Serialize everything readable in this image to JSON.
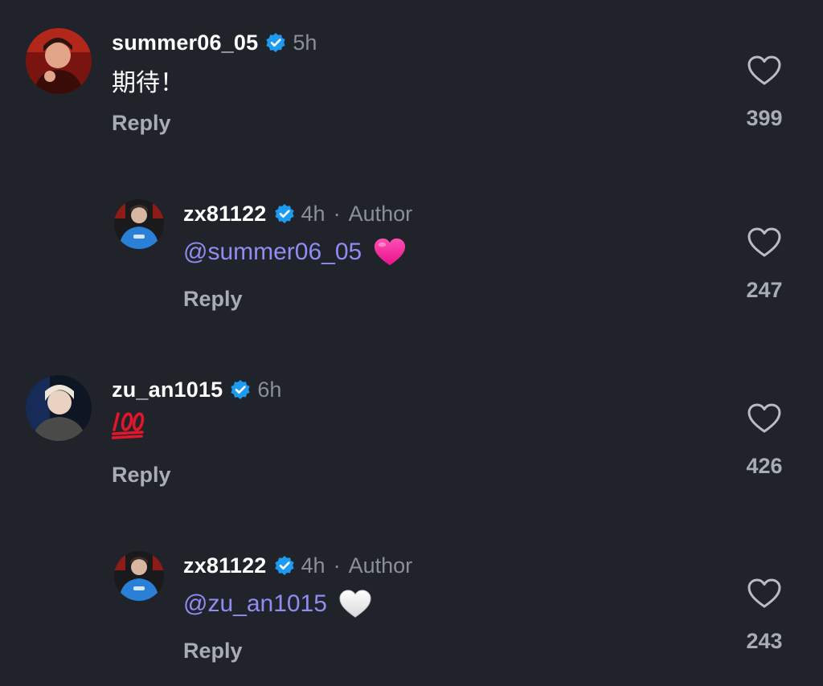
{
  "colors": {
    "background": "#202329",
    "mention": "#8f8cf2",
    "verified": "#1d9bf0",
    "muted": "#8a8f98"
  },
  "comments": [
    {
      "username": "summer06_05",
      "time": "5h",
      "text": "期待！",
      "reply_label": "Reply",
      "likes": "399",
      "verified_icon": "verified-badge-icon",
      "like_icon": "heart-outline-icon"
    },
    {
      "username": "zx81122",
      "time": "4h",
      "separator": "·",
      "author_label": "Author",
      "mention": "@summer06_05",
      "emoji": "pink-heart-emoji",
      "reply_label": "Reply",
      "likes": "247",
      "verified_icon": "verified-badge-icon",
      "like_icon": "heart-outline-icon"
    },
    {
      "username": "zu_an1015",
      "time": "6h",
      "emoji": "hundred-points-emoji",
      "reply_label": "Reply",
      "likes": "426",
      "verified_icon": "verified-badge-icon",
      "like_icon": "heart-outline-icon"
    },
    {
      "username": "zx81122",
      "time": "4h",
      "separator": "·",
      "author_label": "Author",
      "mention": "@zu_an1015",
      "emoji": "white-heart-emoji",
      "reply_label": "Reply",
      "likes": "243",
      "verified_icon": "verified-badge-icon",
      "like_icon": "heart-outline-icon"
    }
  ]
}
